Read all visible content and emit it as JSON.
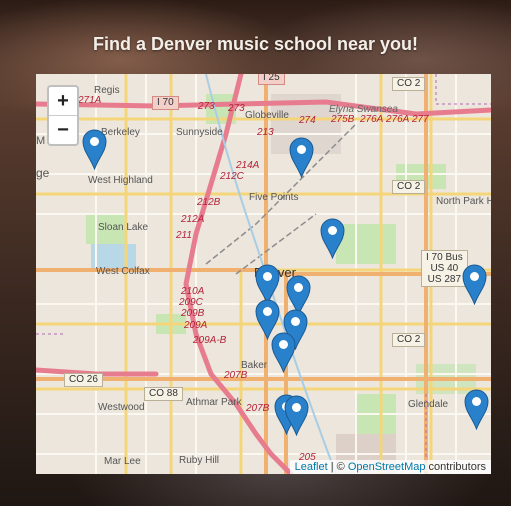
{
  "page": {
    "title": "Find a Denver music school near you!"
  },
  "map": {
    "zoom_in": "+",
    "zoom_out": "−",
    "attribution": {
      "leaflet": "Leaflet",
      "separator": " | © ",
      "osm": "OpenStreetMap",
      "suffix": " contributors"
    },
    "labels": {
      "regis": "Regis",
      "berkeley": "Berkeley",
      "sunnyside": "Sunnyside",
      "globeville": "Globeville",
      "elyria": "Elyria Swansea",
      "west_highland": "West Highland",
      "five_points": "Five Points",
      "sloan_lake": "Sloan Lake",
      "west_colfax": "West Colfax",
      "denver": "Denver",
      "north_park_hill": "North Park Hill",
      "baker": "Baker",
      "westwood": "Westwood",
      "athmar_park": "Athmar Park",
      "glendale": "Glendale",
      "mar_lee": "Mar Lee",
      "ruby_hill": "Ruby Hill",
      "ge": "ge",
      "m": "M"
    },
    "highway_labels": {
      "h271a": "271A",
      "h273a": "273",
      "h273b": "273",
      "h274": "274",
      "h275b": "275B",
      "h276a": "276A",
      "h276a2": "276A",
      "h277": "277",
      "h213": "213",
      "h214a": "214A",
      "h212c": "212C",
      "h212b": "212B",
      "h212a": "212A",
      "h211": "211",
      "h210a": "210A",
      "h209c": "209C",
      "h209b": "209B",
      "h209a": "209A",
      "h209ab": "209A-B",
      "h207b": "207B",
      "h207b2": "207B",
      "h205": "205"
    },
    "shields": {
      "i25": "I 25",
      "i70": "I 70",
      "co2_top": "CO 2",
      "co2_mid": "CO 2",
      "co2_low": "CO 2",
      "co26": "CO 26",
      "co88": "CO 88"
    },
    "route_box": [
      "I 70 Bus",
      "US 40",
      "US 287"
    ],
    "marker_color": "#2a81cb",
    "marker_count": 12
  }
}
